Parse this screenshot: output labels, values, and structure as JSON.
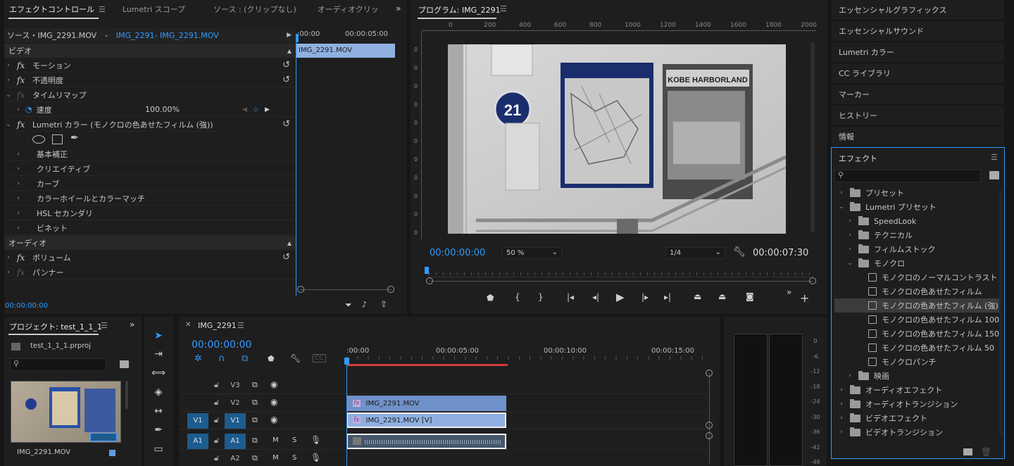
{
  "effect_controls": {
    "tabs": [
      "エフェクトコントロール",
      "Lumetri スコープ",
      "ソース : (クリップなし)",
      "オーディオクリッ"
    ],
    "source_label": "ソース・IMG_2291.MOV",
    "sequence_label": "IMG_2291- IMG_2291.MOV",
    "tl_start": ":00:00",
    "tl_end": "00:00:05:00",
    "clip_name": "IMG_2291.MOV",
    "video_section": "ビデオ",
    "motion": "モーション",
    "opacity": "不透明度",
    "time_remap": "タイムリマップ",
    "speed_label": "速度",
    "speed_value": "100.00%",
    "lumetri": "Lumetri カラー (モノクロの色あせたフィルム (強))",
    "lumetri_items": [
      "基本補正",
      "クリエイティブ",
      "カーブ",
      "カラーホイールとカラーマッチ",
      "HSL セカンダリ",
      "ビネット"
    ],
    "audio_section": "オーディオ",
    "volume": "ボリューム",
    "panner": "パンナー",
    "timecode": "00:00:00:00"
  },
  "program": {
    "title": "プログラム: IMG_2291",
    "ruler_ticks": [
      "0",
      "200",
      "400",
      "600",
      "800",
      "1000",
      "1200",
      "1400",
      "1600",
      "1800",
      "2000"
    ],
    "vruler_ticks": [
      "0",
      "0",
      "0",
      "0",
      "0",
      "0",
      "0",
      "0",
      "0",
      "0",
      "0"
    ],
    "timecode": "00:00:00:00",
    "zoom": "50 %",
    "quality": "1/4",
    "duration": "00:00:07:30",
    "image_sign_number": "21",
    "image_sign_text": "KOBE HARBORLAND"
  },
  "right_panels": [
    "エッセンシャルグラフィックス",
    "エッセンシャルサウンド",
    "Lumetri カラー",
    "CC ライブラリ",
    "マーカー",
    "ヒストリー",
    "情報"
  ],
  "effects": {
    "title": "エフェクト",
    "tree": [
      {
        "label": "プリセット",
        "kind": "folder",
        "level": 0,
        "open": false
      },
      {
        "label": "Lumetri プリセット",
        "kind": "folder",
        "level": 0,
        "open": true
      },
      {
        "label": "SpeedLook",
        "kind": "folder",
        "level": 1,
        "open": false
      },
      {
        "label": "テクニカル",
        "kind": "folder",
        "level": 1,
        "open": false
      },
      {
        "label": "フィルムストック",
        "kind": "folder",
        "level": 1,
        "open": false
      },
      {
        "label": "モノクロ",
        "kind": "folder",
        "level": 1,
        "open": true
      },
      {
        "label": "モノクロのノーマルコントラスト",
        "kind": "preset",
        "level": 2
      },
      {
        "label": "モノクロの色あせたフィルム",
        "kind": "preset",
        "level": 2
      },
      {
        "label": "モノクロの色あせたフィルム (強)",
        "kind": "preset",
        "level": 2,
        "selected": true
      },
      {
        "label": "モノクロの色あせたフィルム 100",
        "kind": "preset",
        "level": 2
      },
      {
        "label": "モノクロの色あせたフィルム 150",
        "kind": "preset",
        "level": 2
      },
      {
        "label": "モノクロの色あせたフィルム 50",
        "kind": "preset",
        "level": 2
      },
      {
        "label": "モノクロパンチ",
        "kind": "preset",
        "level": 2
      },
      {
        "label": "映画",
        "kind": "folder",
        "level": 1,
        "open": false
      },
      {
        "label": "オーディオエフェクト",
        "kind": "folder",
        "level": 0,
        "open": false
      },
      {
        "label": "オーディオトランジション",
        "kind": "folder",
        "level": 0,
        "open": false
      },
      {
        "label": "ビデオエフェクト",
        "kind": "folder",
        "level": 0,
        "open": false
      },
      {
        "label": "ビデオトランジション",
        "kind": "folder",
        "level": 0,
        "open": false
      }
    ]
  },
  "project": {
    "title": "プロジェクト: test_1_1_1",
    "file": "test_1_1_1.prproj",
    "clip": "IMG_2291.MOV"
  },
  "timeline": {
    "title": "IMG_2291",
    "timecode": "00:00:00:00",
    "ruler": [
      ":00:00",
      "00:00:05:00",
      "00:00:10:00",
      "00:00:15:00"
    ],
    "tracks": [
      {
        "src": "",
        "name": "V3",
        "type": "video"
      },
      {
        "src": "",
        "name": "V2",
        "type": "video"
      },
      {
        "src": "V1",
        "name": "V1",
        "type": "video"
      },
      {
        "src": "A1",
        "name": "A1",
        "type": "audio"
      },
      {
        "src": "",
        "name": "A2",
        "type": "audio"
      }
    ],
    "clip_v2": "IMG_2291.MOV",
    "clip_v1": "IMG_2291.MOV [V]",
    "mute_label": "M",
    "solo_label": "S"
  },
  "meter": {
    "labels": [
      "0",
      "-6",
      "-12",
      "-18",
      "-24",
      "-30",
      "-36",
      "-42",
      "-48"
    ]
  },
  "colors": {
    "accent": "#2f9bff",
    "clip_video": "#8fb0e0",
    "clip_v2": "#6f91c9",
    "clip_audio": "#8fb0e0",
    "work_area": "#d23b3b"
  }
}
